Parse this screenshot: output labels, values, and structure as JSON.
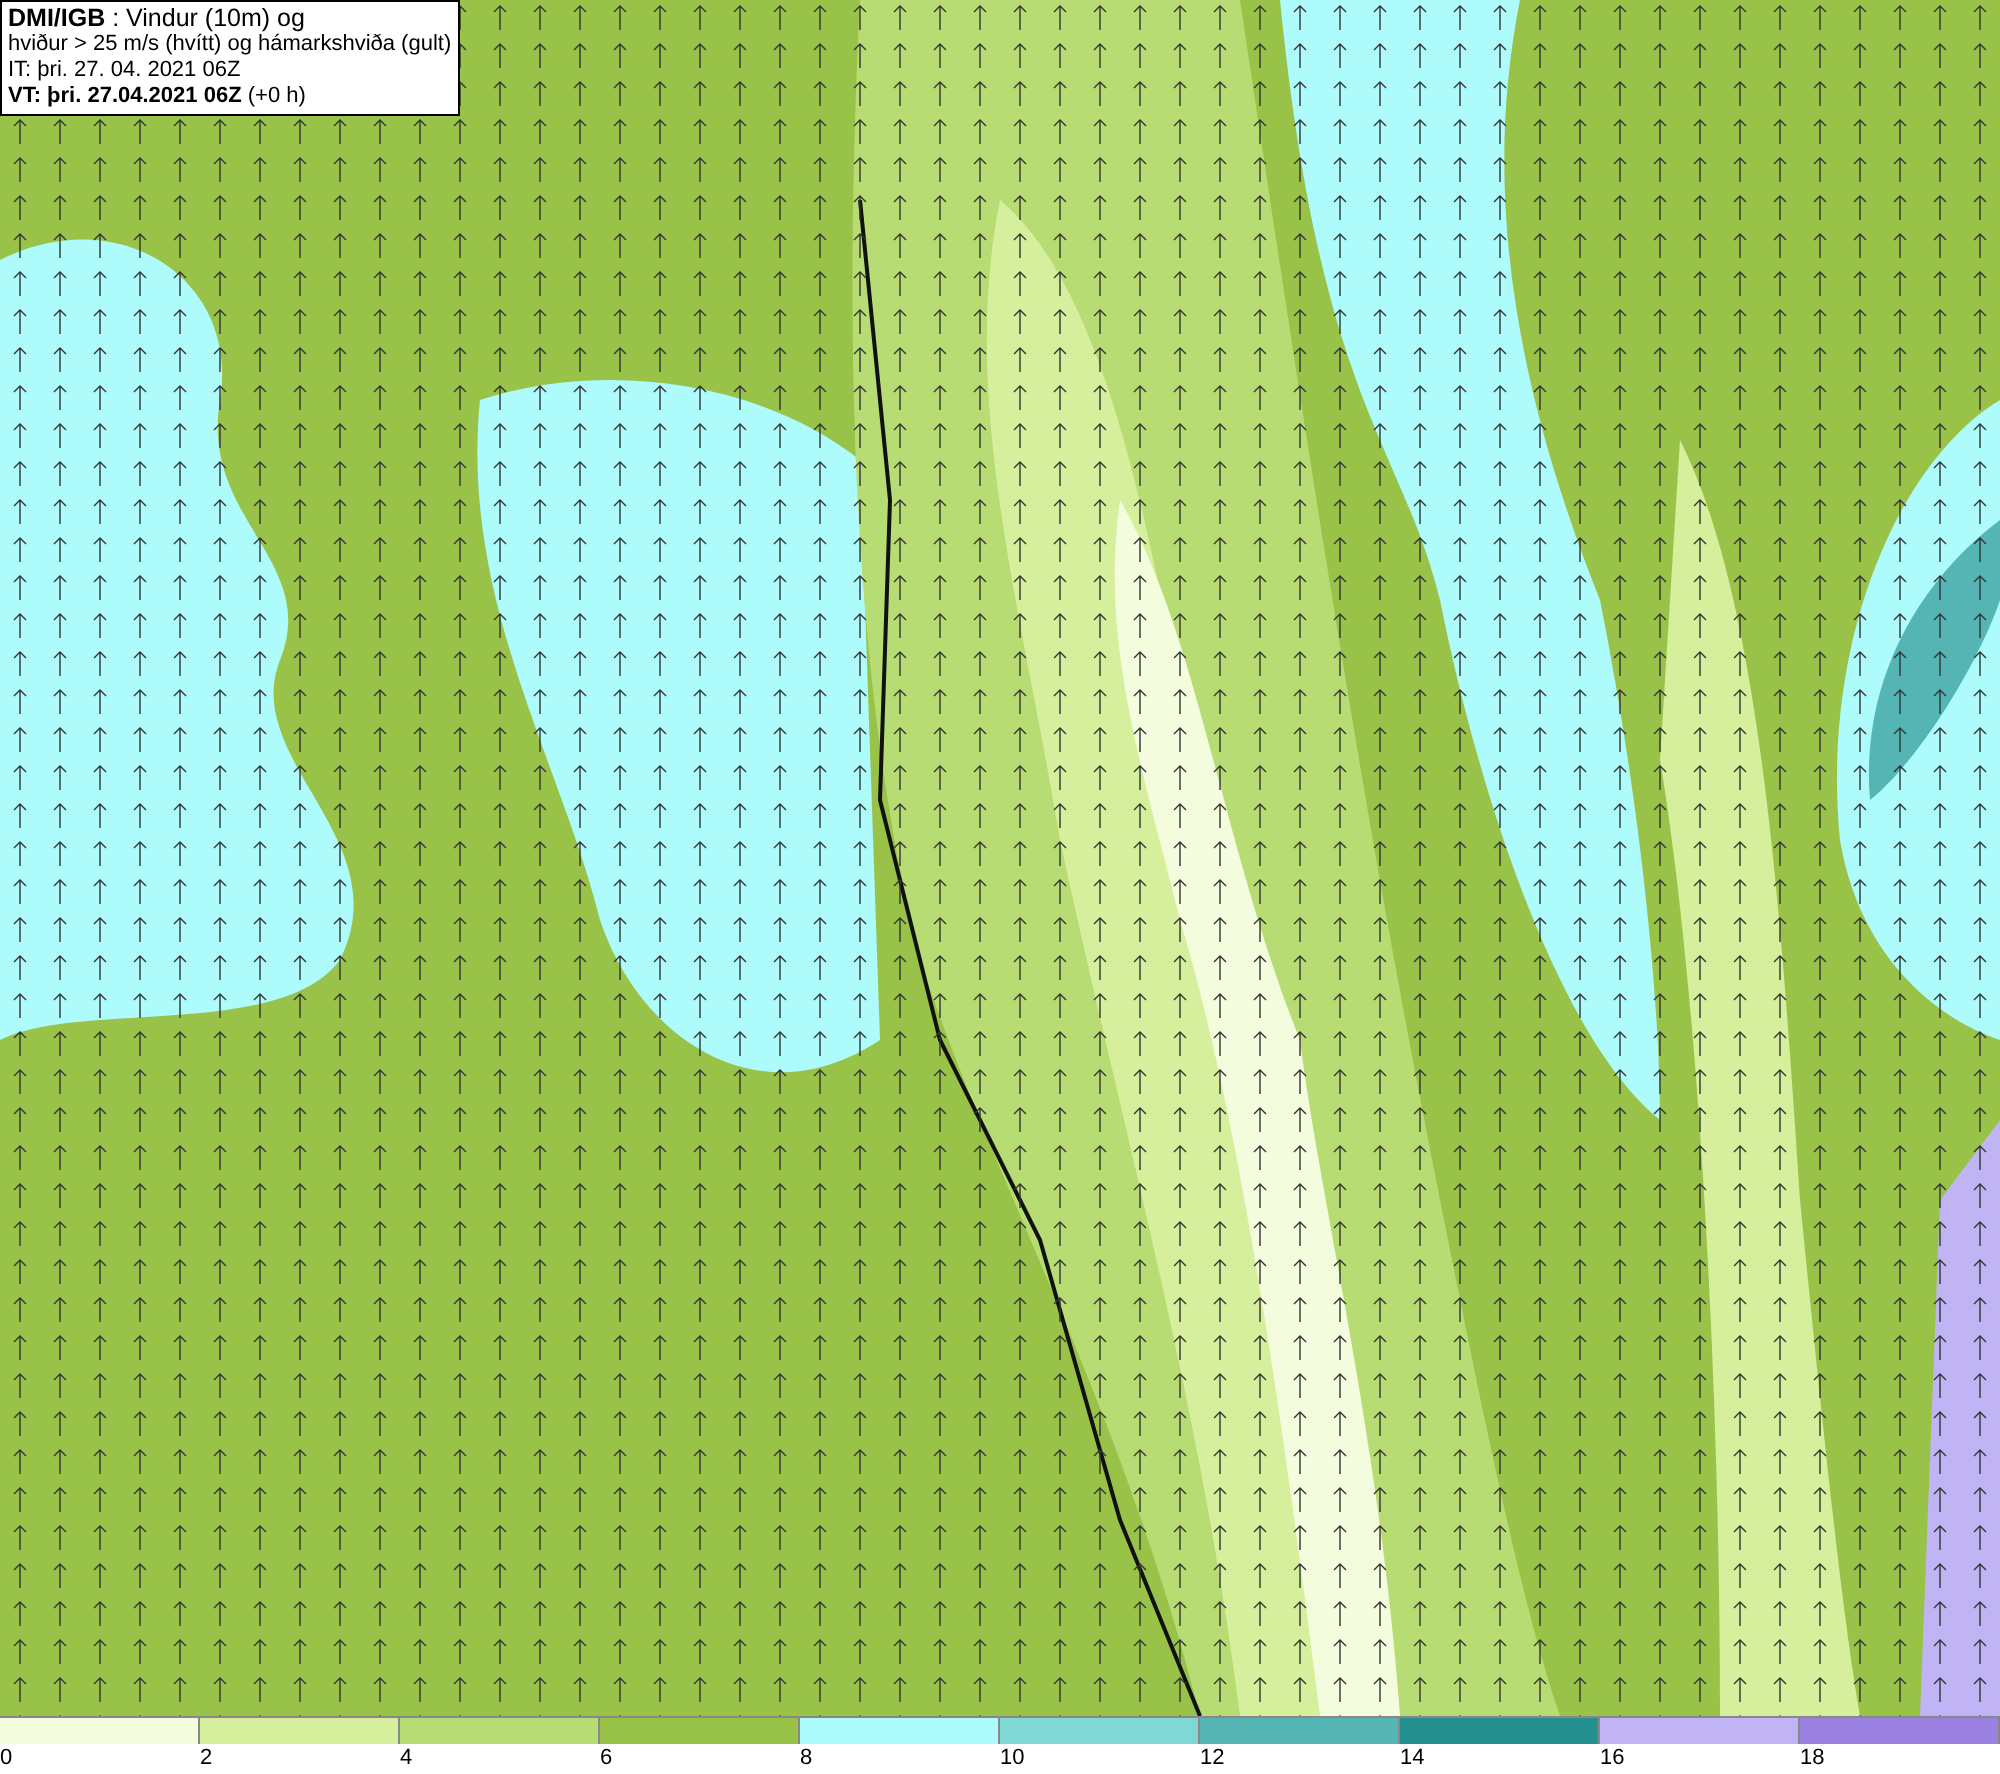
{
  "legend": {
    "lines": [
      "**DMI/IGB** : Vindur (10m) og",
      "hviður > 25 m/s (hvítt) og hámarkshviða (gult)",
      "IT: þri. 27. 04. 2021 06Z",
      "**VT: þri. 27.04.2021 06Z** (+0 h)"
    ]
  },
  "colorbar": {
    "segments": [
      {
        "color": "#f3fcdc",
        "label": "0"
      },
      {
        "color": "#d5ef9c",
        "label": "2"
      },
      {
        "color": "#b8dc74",
        "label": "4"
      },
      {
        "color": "#99c248",
        "label": "6"
      },
      {
        "color": "#aefbfb",
        "label": "8"
      },
      {
        "color": "#7fd8d4",
        "label": "10"
      },
      {
        "color": "#55b5b4",
        "label": "12"
      },
      {
        "color": "#259090",
        "label": "14"
      },
      {
        "color": "#c0b4f4",
        "label": "16"
      },
      {
        "color": "#9a80e0",
        "label": "18"
      }
    ]
  }
}
